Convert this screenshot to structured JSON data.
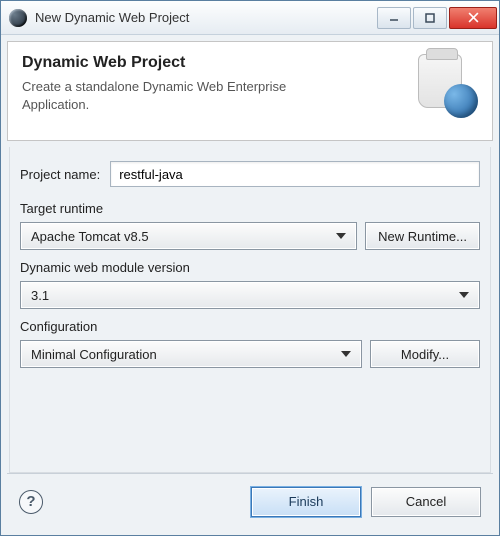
{
  "window": {
    "title": "New Dynamic Web Project"
  },
  "banner": {
    "title": "Dynamic Web Project",
    "description": "Create a standalone Dynamic Web Enterprise Application."
  },
  "form": {
    "project_name_label": "Project name:",
    "project_name_value": "restful-java",
    "target_runtime": {
      "label": "Target runtime",
      "value": "Apache Tomcat v8.5",
      "new_button": "New Runtime..."
    },
    "module_version": {
      "label": "Dynamic web module version",
      "value": "3.1"
    },
    "configuration": {
      "label": "Configuration",
      "value": "Minimal Configuration",
      "modify_button": "Modify..."
    }
  },
  "footer": {
    "finish": "Finish",
    "cancel": "Cancel"
  }
}
